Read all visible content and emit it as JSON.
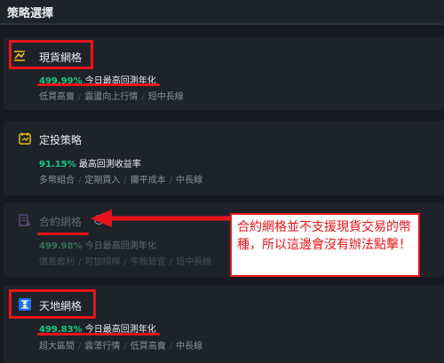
{
  "header": {
    "title": "策略選擇"
  },
  "cards": [
    {
      "name": "現貨網格",
      "pct": "499.99%",
      "metric": "今日最高回測年化",
      "tags": [
        "低買高賣",
        "震盪向上行情",
        "短中長線"
      ]
    },
    {
      "name": "定投策略",
      "pct": "91.15%",
      "metric": "最高回測收益率",
      "tags": [
        "多幣組合",
        "定期買入",
        "攤平成本",
        "中長線"
      ]
    },
    {
      "name": "合約網格",
      "pct": "499.98%",
      "metric": "今日最高回測年化",
      "tags": [
        "價差套利",
        "可加槓桿",
        "牛熊皆宜",
        "短中長線"
      ]
    },
    {
      "name": "天地網格",
      "pct": "499.83%",
      "metric": "今日最高回測年化",
      "tags": [
        "超大區間",
        "震蕩行情",
        "低買高賣",
        "中長線"
      ]
    }
  ],
  "annotation": {
    "text": "合約網格並不支援現貨交易的幣種，所以這邊會沒有辦法點擊！"
  },
  "colors": {
    "accent_red": "#e8141b",
    "profit_green": "#0ecb81",
    "brand_yellow": "#f0b90b"
  },
  "icons": [
    "spot-grid-icon",
    "dca-calendar-icon",
    "futures-grid-icon",
    "help-icon",
    "infinity-grid-icon"
  ]
}
